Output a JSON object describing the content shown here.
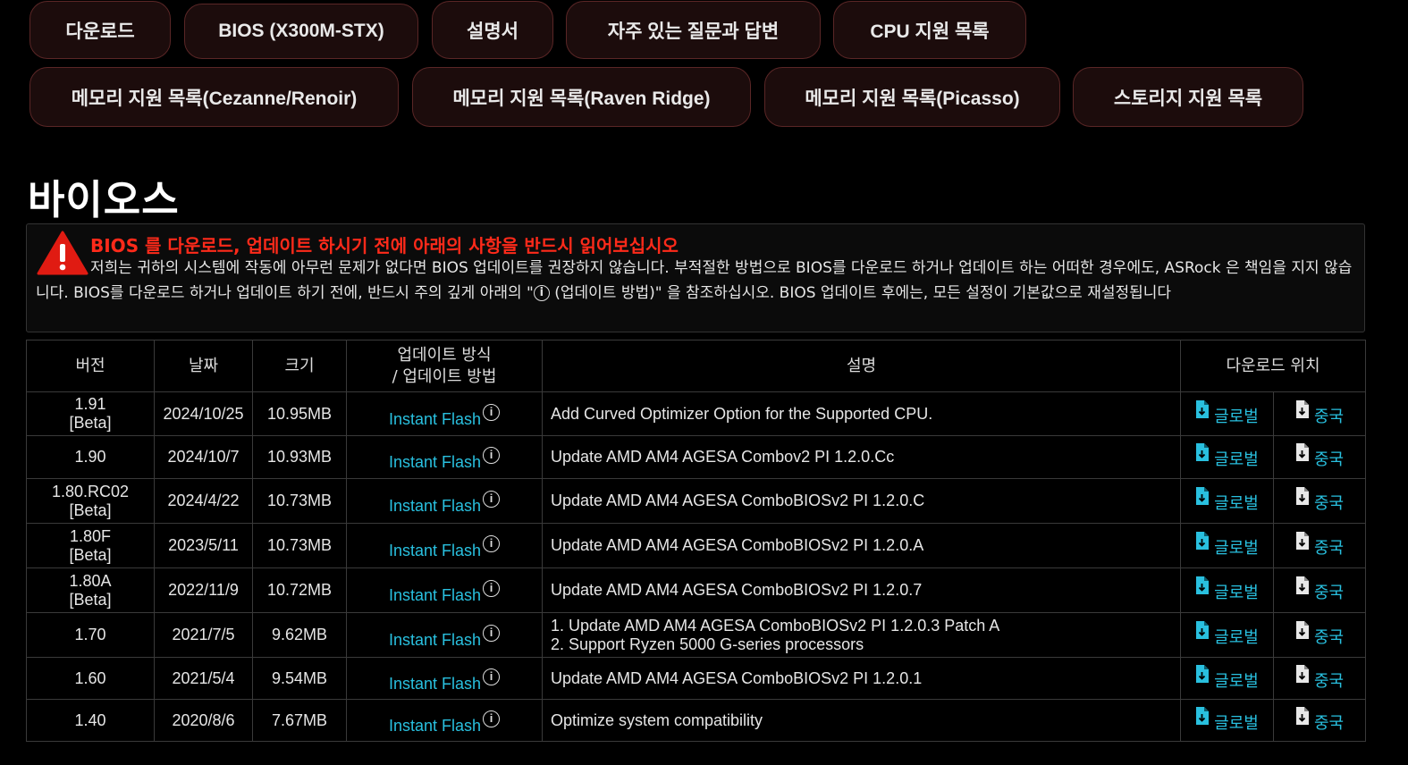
{
  "tabs_row1": [
    {
      "label": "다운로드"
    },
    {
      "label": "BIOS (X300M-STX)"
    },
    {
      "label": "설명서"
    },
    {
      "label": "자주 있는 질문과 답변"
    },
    {
      "label": "CPU 지원 목록"
    }
  ],
  "tabs_row2": [
    {
      "label": "메모리 지원 목록(Cezanne/Renoir)"
    },
    {
      "label": "메모리 지원 목록(Raven Ridge)"
    },
    {
      "label": "메모리 지원 목록(Picasso)"
    },
    {
      "label": "스토리지 지원 목록"
    }
  ],
  "page_title": "바이오스",
  "warning": {
    "title": "BIOS 를 다운로드, 업데이트 하시기 전에 아래의 사항을 반드시 읽어보십시오",
    "body_part1": "저희는 귀하의 시스템에 작동에 아무런 문제가 없다면 BIOS 업데이트를 권장하지 않습니다. 부적절한 방법으로 BIOS를 다운로드 하거나 업데이트 하는 어떠한 경우에도, ASRock 은 책임을 지지 않습니다. BIOS를 다운로드 하거나 업데이트 하기 전에, 반드시 주의 깊게 아래의 \"",
    "body_part2": " (업데이트 방법)\" 을 참조하십시오. BIOS 업데이트 후에는, 모든 설정이 기본값으로 재설정됩니다"
  },
  "table": {
    "headers": {
      "version": "버전",
      "date": "날짜",
      "size": "크기",
      "method_line1": "업데이트 방식",
      "method_line2": "/ 업데이트 방법",
      "description": "설명",
      "download": "다운로드 위치"
    },
    "rows": [
      {
        "version": "1.91",
        "tag": "[Beta]",
        "date": "2024/10/25",
        "size": "10.95MB",
        "method": "Instant Flash",
        "desc1": "Add Curved Optimizer Option for the Supported CPU.",
        "desc2": "",
        "dl_global": "글로벌",
        "dl_china": "중국"
      },
      {
        "version": "1.90",
        "tag": "",
        "date": "2024/10/7",
        "size": "10.93MB",
        "method": "Instant Flash",
        "desc1": "Update AMD AM4 AGESA Combov2 PI 1.2.0.Cc",
        "desc2": "",
        "dl_global": "글로벌",
        "dl_china": "중국"
      },
      {
        "version": "1.80.RC02",
        "tag": "[Beta]",
        "date": "2024/4/22",
        "size": "10.73MB",
        "method": "Instant Flash",
        "desc1": "Update AMD AM4 AGESA ComboBIOSv2 PI 1.2.0.C",
        "desc2": "",
        "dl_global": "글로벌",
        "dl_china": "중국"
      },
      {
        "version": "1.80F",
        "tag": "[Beta]",
        "date": "2023/5/11",
        "size": "10.73MB",
        "method": "Instant Flash",
        "desc1": "Update AMD AM4 AGESA ComboBIOSv2 PI 1.2.0.A",
        "desc2": "",
        "dl_global": "글로벌",
        "dl_china": "중국"
      },
      {
        "version": "1.80A",
        "tag": "[Beta]",
        "date": "2022/11/9",
        "size": "10.72MB",
        "method": "Instant Flash",
        "desc1": "Update AMD AM4 AGESA ComboBIOSv2 PI 1.2.0.7",
        "desc2": "",
        "dl_global": "글로벌",
        "dl_china": "중국"
      },
      {
        "version": "1.70",
        "tag": "",
        "date": "2021/7/5",
        "size": "9.62MB",
        "method": "Instant Flash",
        "desc1": "1. Update AMD AM4 AGESA ComboBIOSv2 PI 1.2.0.3 Patch A",
        "desc2": "2. Support Ryzen 5000 G-series processors",
        "dl_global": "글로벌",
        "dl_china": "중국"
      },
      {
        "version": "1.60",
        "tag": "",
        "date": "2021/5/4",
        "size": "9.54MB",
        "method": "Instant Flash",
        "desc1": "Update AMD AM4 AGESA ComboBIOSv2 PI 1.2.0.1",
        "desc2": "",
        "dl_global": "글로벌",
        "dl_china": "중국"
      },
      {
        "version": "1.40",
        "tag": "",
        "date": "2020/8/6",
        "size": "7.67MB",
        "method": "Instant Flash",
        "desc1": "Optimize system compatibility",
        "desc2": "",
        "dl_global": "글로벌",
        "dl_china": "중국"
      }
    ]
  },
  "colors": {
    "background": "#000000",
    "tab_fill": "#1c0c0c",
    "tab_border": "#5a2626",
    "warning_red": "#ff2a1a",
    "link": "#29c0df"
  },
  "icons": {
    "warning": "warning-triangle-icon",
    "info": "info-circle-icon",
    "download": "file-download-icon"
  }
}
